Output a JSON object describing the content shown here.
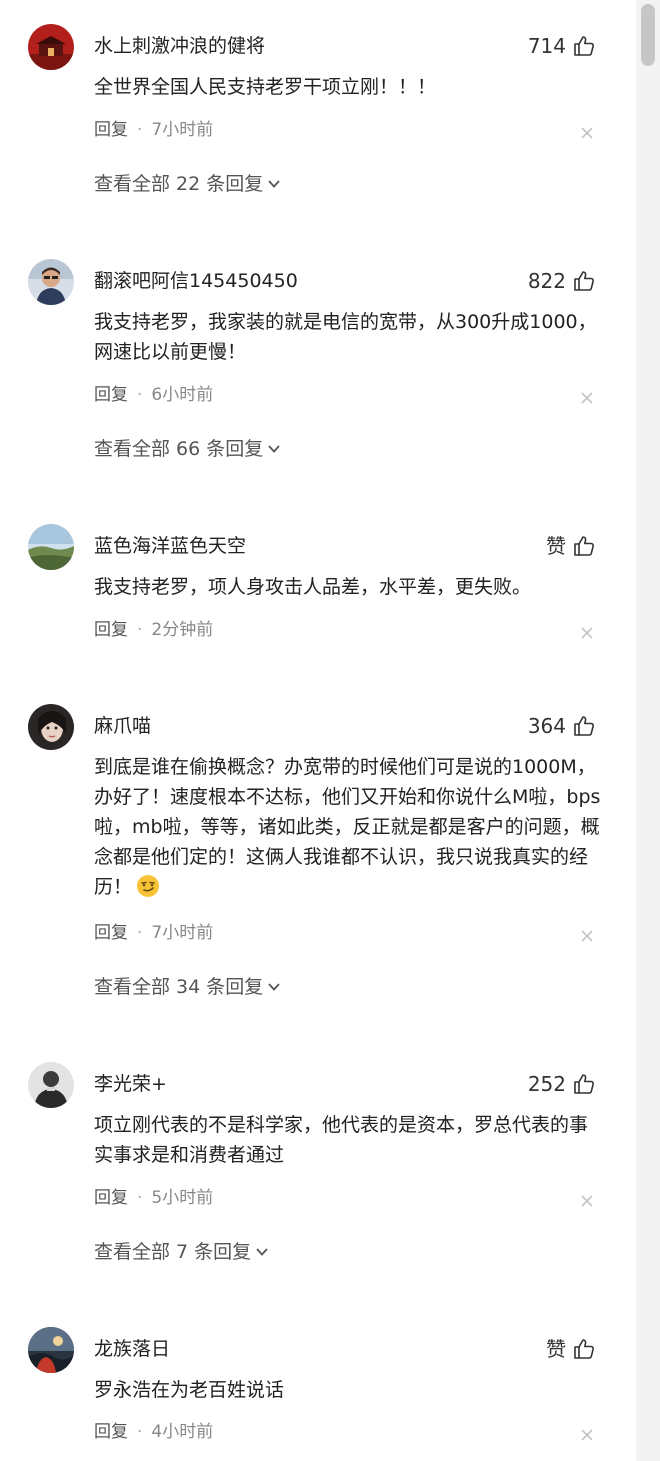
{
  "labels": {
    "reply": "回复",
    "separator": "·"
  },
  "comments": [
    {
      "username": "水上刺激冲浪的健将",
      "likes": "714",
      "text": "全世界全国人民支持老罗干项立刚！！！",
      "time": "7小时前",
      "view_all": "查看全部 22 条回复"
    },
    {
      "username": "翻滚吧阿信145450450",
      "likes": "822",
      "text": "我支持老罗，我家装的就是电信的宽带，从300升成1000，网速比以前更慢！",
      "time": "6小时前",
      "view_all": "查看全部 66 条回复"
    },
    {
      "username": "蓝色海洋蓝色天空",
      "likes": "赞",
      "text": "我支持老罗，项人身攻击人品差，水平差，更失败。",
      "time": "2分钟前"
    },
    {
      "username": "麻爪喵",
      "likes": "364",
      "text": "到底是谁在偷换概念？办宽带的时候他们可是说的1000M，办好了！速度根本不达标，他们又开始和你说什么M啦，bps啦，mb啦，等等，诸如此类，反正就是都是客户的问题，概念都是他们定的！这俩人我谁都不认识，我只说我真实的经历！",
      "emoji": "smirk-emoji",
      "time": "7小时前",
      "view_all": "查看全部 34 条回复"
    },
    {
      "username": "李光荣+",
      "likes": "252",
      "text": "项立刚代表的不是科学家，他代表的是资本，罗总代表的事实事求是和消费者通过",
      "time": "5小时前",
      "view_all": "查看全部 7 条回复"
    },
    {
      "username": "龙族落日",
      "likes": "赞",
      "text": "罗永浩在为老百姓说话",
      "time": "4小时前"
    }
  ],
  "icons": {
    "like": "thumbs-up-icon",
    "close": "close-icon",
    "expand": "chevron-down-icon"
  },
  "colors": {
    "text": "#222222",
    "muted": "#888888",
    "link": "#555555",
    "scrollbar_track": "#f3f3f3",
    "scrollbar_thumb": "#c6c6c6"
  }
}
